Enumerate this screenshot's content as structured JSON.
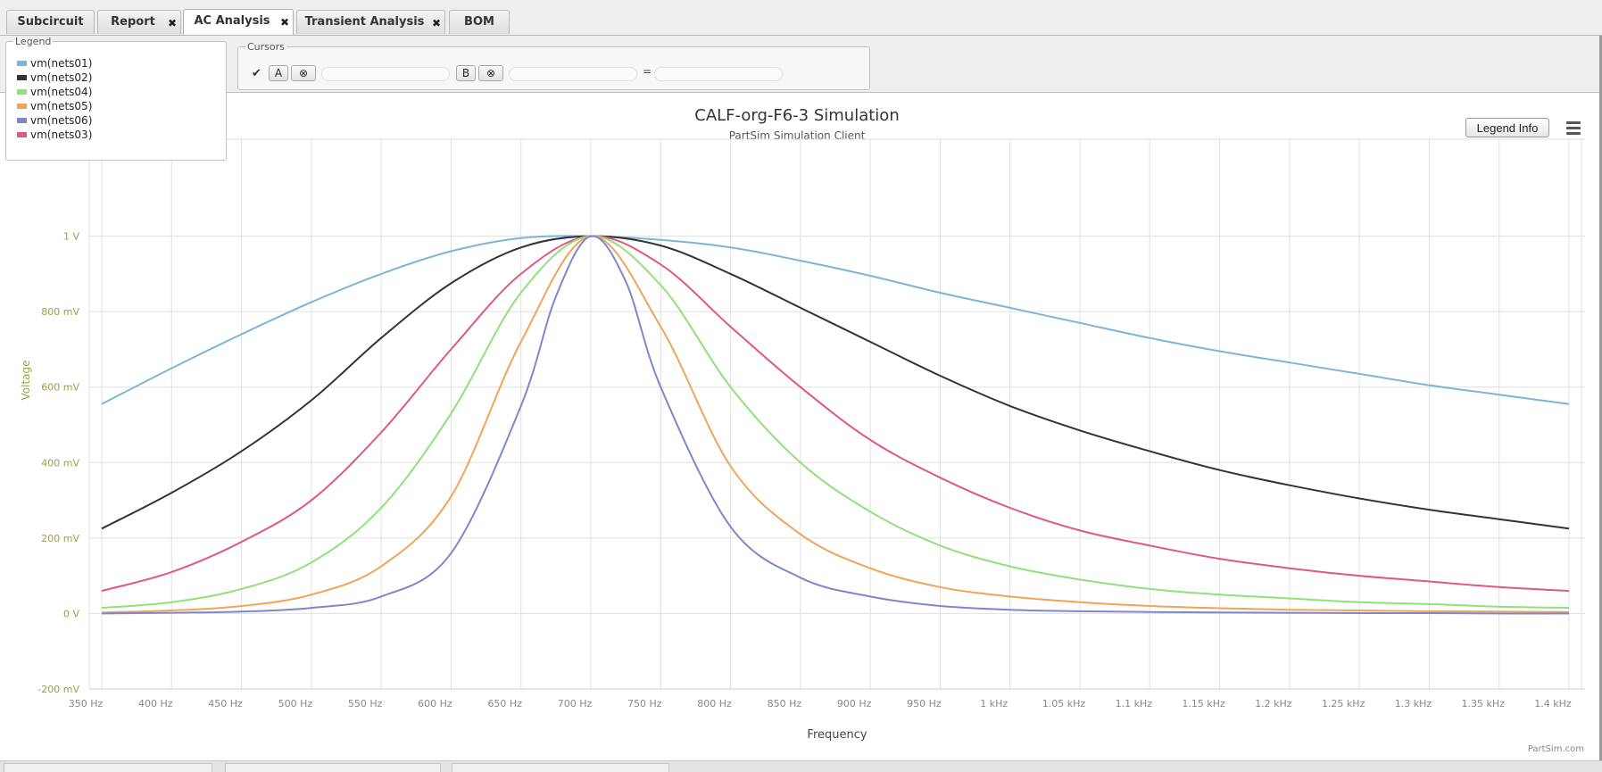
{
  "tabs": [
    {
      "label": "Subcircuit",
      "closable": false,
      "active": false
    },
    {
      "label": "Report",
      "closable": true,
      "active": false
    },
    {
      "label": "AC Analysis",
      "closable": true,
      "active": true
    },
    {
      "label": "Transient Analysis",
      "closable": true,
      "active": false
    },
    {
      "label": "BOM",
      "closable": false,
      "active": false
    }
  ],
  "tab_close_glyph": "✖",
  "legend_panel": {
    "title": "Legend",
    "items": [
      {
        "label": "vm(nets01)",
        "color": "#7cb5d8"
      },
      {
        "label": "vm(nets02)",
        "color": "#333333"
      },
      {
        "label": "vm(nets04)",
        "color": "#90e07c"
      },
      {
        "label": "vm(nets05)",
        "color": "#f0a458"
      },
      {
        "label": "vm(nets06)",
        "color": "#8086cc"
      },
      {
        "label": "vm(nets03)",
        "color": "#e0587e"
      }
    ]
  },
  "cursors": {
    "title": "Cursors",
    "check_glyph": "✔",
    "cursor_a_label": "A",
    "cursor_b_label": "B",
    "clear_glyph": "⊗",
    "equals": "="
  },
  "legend_info_button": "Legend Info",
  "menu_icon": "hamburger-icon",
  "credit": "PartSim.com",
  "chart_data": {
    "type": "line",
    "title": "CALF-org-F6-3 Simulation",
    "subtitle": "PartSim Simulation Client",
    "xlabel": "Frequency",
    "ylabel": "Voltage",
    "x_scale": "linear",
    "x_unit": "Hz",
    "xlim": [
      350,
      1400
    ],
    "ylim": [
      -0.2,
      1.2
    ],
    "x_ticks": [
      350,
      400,
      450,
      500,
      550,
      600,
      650,
      700,
      750,
      800,
      850,
      900,
      950,
      1000,
      1050,
      1100,
      1150,
      1200,
      1250,
      1300,
      1350,
      1400
    ],
    "x_tick_labels": [
      "350 Hz",
      "400 Hz",
      "450 Hz",
      "500 Hz",
      "550 Hz",
      "600 Hz",
      "650 Hz",
      "700 Hz",
      "750 Hz",
      "800 Hz",
      "850 Hz",
      "900 Hz",
      "950 Hz",
      "1 kHz",
      "1.05 kHz",
      "1.1 kHz",
      "1.15 kHz",
      "1.2 kHz",
      "1.25 kHz",
      "1.3 kHz",
      "1.35 kHz",
      "1.4 kHz"
    ],
    "y_ticks": [
      -0.2,
      0,
      0.2,
      0.4,
      0.6,
      0.8,
      1.0
    ],
    "y_tick_labels": [
      "-200 mV",
      "0 V",
      "200 mV",
      "400 mV",
      "600 mV",
      "800 mV",
      "1 V"
    ],
    "grid": true,
    "legend": "top-left",
    "series": [
      {
        "name": "vm(nets01)",
        "color": "#7cb5d8",
        "x": [
          350,
          400,
          450,
          500,
          550,
          600,
          650,
          700,
          750,
          800,
          850,
          900,
          950,
          1000,
          1050,
          1100,
          1150,
          1200,
          1250,
          1300,
          1350,
          1400
        ],
        "y": [
          0.555,
          0.65,
          0.74,
          0.825,
          0.9,
          0.96,
          0.995,
          1.0,
          0.99,
          0.97,
          0.935,
          0.895,
          0.85,
          0.81,
          0.77,
          0.73,
          0.695,
          0.665,
          0.635,
          0.605,
          0.58,
          0.555
        ]
      },
      {
        "name": "vm(nets02)",
        "color": "#333333",
        "x": [
          350,
          400,
          450,
          500,
          550,
          600,
          650,
          700,
          750,
          800,
          850,
          900,
          950,
          1000,
          1050,
          1100,
          1150,
          1200,
          1250,
          1300,
          1350,
          1400
        ],
        "y": [
          0.225,
          0.32,
          0.43,
          0.565,
          0.73,
          0.875,
          0.97,
          1.0,
          0.975,
          0.9,
          0.81,
          0.72,
          0.63,
          0.55,
          0.485,
          0.43,
          0.38,
          0.34,
          0.305,
          0.275,
          0.25,
          0.225
        ]
      },
      {
        "name": "vm(nets03)",
        "color": "#e0587e",
        "x": [
          350,
          400,
          450,
          500,
          550,
          600,
          650,
          700,
          750,
          800,
          850,
          900,
          950,
          1000,
          1050,
          1100,
          1150,
          1200,
          1250,
          1300,
          1350,
          1400
        ],
        "y": [
          0.06,
          0.11,
          0.19,
          0.3,
          0.48,
          0.7,
          0.9,
          1.0,
          0.925,
          0.76,
          0.6,
          0.46,
          0.36,
          0.28,
          0.22,
          0.18,
          0.145,
          0.12,
          0.1,
          0.085,
          0.07,
          0.06
        ]
      },
      {
        "name": "vm(nets04)",
        "color": "#90e07c",
        "x": [
          350,
          400,
          450,
          500,
          550,
          600,
          650,
          700,
          750,
          800,
          850,
          900,
          950,
          1000,
          1050,
          1100,
          1150,
          1200,
          1250,
          1300,
          1350,
          1400
        ],
        "y": [
          0.015,
          0.03,
          0.065,
          0.135,
          0.28,
          0.53,
          0.85,
          1.0,
          0.87,
          0.6,
          0.4,
          0.27,
          0.18,
          0.125,
          0.09,
          0.065,
          0.05,
          0.04,
          0.03,
          0.025,
          0.018,
          0.015
        ]
      },
      {
        "name": "vm(nets05)",
        "color": "#f0a458",
        "x": [
          350,
          400,
          450,
          500,
          550,
          600,
          650,
          700,
          750,
          800,
          850,
          900,
          950,
          1000,
          1050,
          1100,
          1150,
          1200,
          1250,
          1300,
          1350,
          1400
        ],
        "y": [
          0.003,
          0.008,
          0.02,
          0.05,
          0.125,
          0.31,
          0.72,
          1.0,
          0.76,
          0.39,
          0.21,
          0.12,
          0.07,
          0.045,
          0.03,
          0.02,
          0.014,
          0.01,
          0.008,
          0.006,
          0.005,
          0.004
        ]
      },
      {
        "name": "vm(nets06)",
        "color": "#8086cc",
        "x": [
          350,
          400,
          450,
          500,
          550,
          600,
          650,
          675,
          700,
          725,
          750,
          800,
          850,
          900,
          950,
          1000,
          1050,
          1100,
          1150,
          1200,
          1250,
          1300,
          1350,
          1400
        ],
        "y": [
          0.0,
          0.002,
          0.005,
          0.015,
          0.045,
          0.16,
          0.55,
          0.84,
          1.0,
          0.88,
          0.6,
          0.23,
          0.095,
          0.045,
          0.02,
          0.01,
          0.006,
          0.004,
          0.003,
          0.002,
          0.001,
          0.001,
          0.0,
          0.0
        ]
      }
    ]
  }
}
